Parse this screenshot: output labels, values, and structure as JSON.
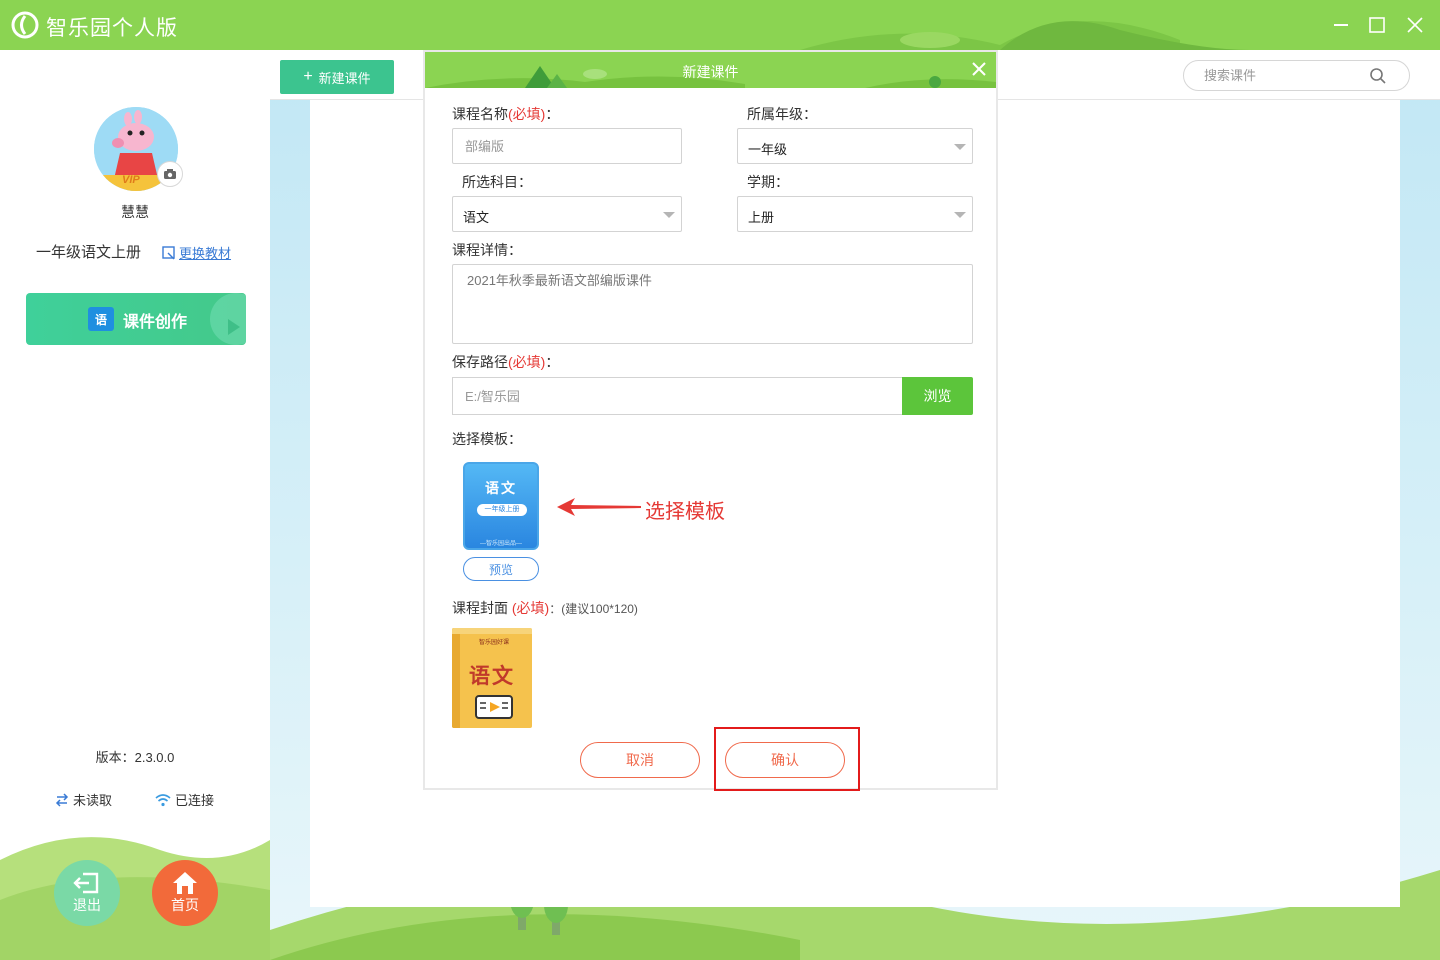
{
  "app": {
    "title": "智乐园个人版",
    "brand_color": "#8bd452",
    "accent_color": "#3cc48f"
  },
  "window_controls": {
    "icons": [
      "minimize-icon",
      "maximize-icon",
      "close-icon"
    ]
  },
  "sidebar": {
    "username": "慧慧",
    "vip_label": "VIP",
    "textbook": "一年级语文上册",
    "change_textbook": "更换教材",
    "create_button": "课件创作",
    "create_icon_text": "语",
    "version": "版本：2.3.0.0",
    "sync_status": "未读取",
    "network_status": "已连接",
    "logout_label": "退出",
    "home_label": "首页"
  },
  "toolbar": {
    "new_button": "新建课件",
    "search_placeholder": "搜索课件"
  },
  "dialog": {
    "title": "新建课件",
    "course_name_label": "课程名称",
    "required_mark": "(必填)",
    "colon": "：",
    "course_name_placeholder": "部编版",
    "grade_label": "所属年级：",
    "grade_value": "一年级",
    "subject_label": "所选科目：",
    "subject_value": "语文",
    "term_label": "学期：",
    "term_value": "上册",
    "details_label": "课程详情：",
    "details_value": "2021年秋季最新语文部编版课件",
    "save_path_label": "保存路径",
    "save_path_placeholder": "E:/智乐园",
    "browse_button": "浏览",
    "template_label": "选择模板：",
    "template_card": {
      "subject": "语文",
      "grade": "一年级上册",
      "footer": "—智乐园出品—"
    },
    "preview_button": "预览",
    "annotation": "选择模板",
    "cover_label": "课程封面",
    "cover_required": "(必填)",
    "cover_hint": "：(建议100*120)",
    "cover_title": "语文",
    "cover_brand": "智乐园好课",
    "cancel_button": "取消",
    "confirm_button": "确认"
  }
}
